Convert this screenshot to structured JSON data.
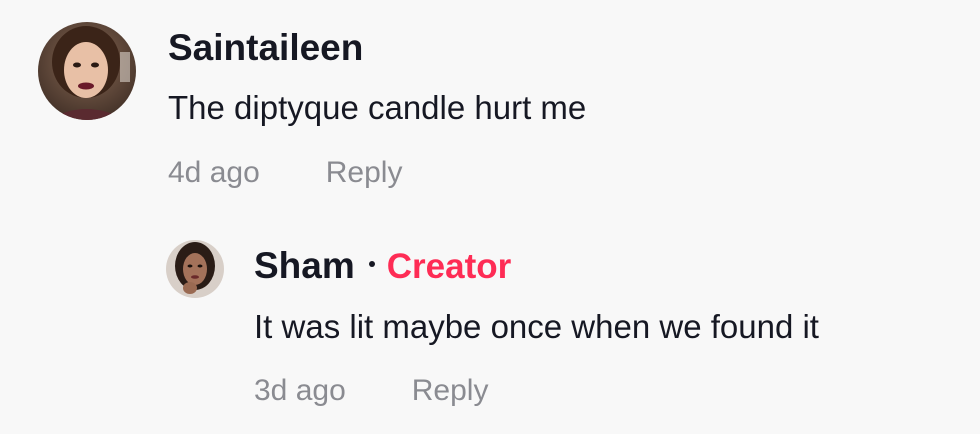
{
  "comments": [
    {
      "username": "Saintaileen",
      "text": "The diptyque candle hurt me",
      "time": "4d ago",
      "reply_label": "Reply",
      "avatar_icon": "profile-photo"
    }
  ],
  "replies": [
    {
      "username": "Sham",
      "badge": "Creator",
      "text": "It was lit maybe once when we found it",
      "time": "3d ago",
      "reply_label": "Reply",
      "avatar_icon": "profile-photo"
    }
  ],
  "colors": {
    "background": "#f8f8f8",
    "text": "#161823",
    "muted": "#8a8b91",
    "creator_badge": "#fe2c55"
  }
}
